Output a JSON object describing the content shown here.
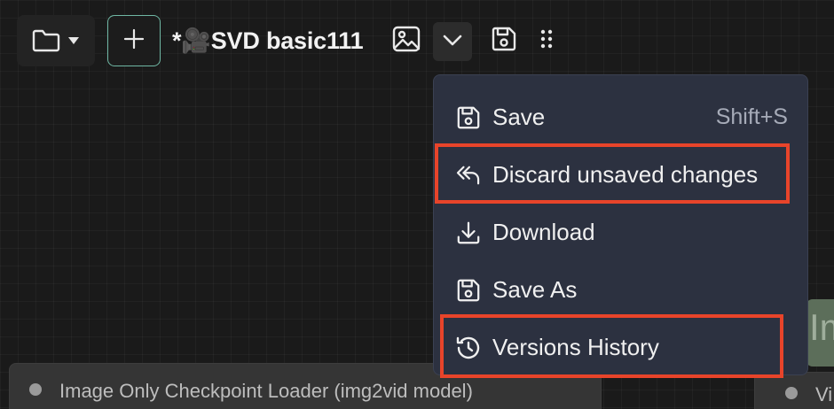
{
  "toolbar": {
    "workflow_title": "*🎥SVD basic111",
    "icons": {
      "workflow_menu": "folder-icon",
      "workflow_menu_caret": "caret-down-icon",
      "new_tab": "plus-icon",
      "image": "image-icon",
      "actions_menu": "chevron-down-icon",
      "save": "save-icon",
      "drag": "drag-handle-icon"
    }
  },
  "dropdown": {
    "items": [
      {
        "label": "Save",
        "shortcut": "Shift+S",
        "icon": "save-icon"
      },
      {
        "label": "Discard unsaved changes",
        "icon": "undo-icon"
      },
      {
        "label": "Download",
        "icon": "download-icon"
      },
      {
        "label": "Save As",
        "icon": "save-icon"
      },
      {
        "label": "Versions History",
        "icon": "history-icon"
      }
    ]
  },
  "canvas": {
    "nodes": [
      {
        "title": "Image Only Checkpoint Loader (img2vid model)"
      },
      {
        "title": "Vi"
      },
      {
        "title": "Ima"
      }
    ]
  },
  "colors": {
    "accent_border": "#6fb7a4",
    "menu_background": "#2c3140",
    "highlight": "#e8442a",
    "canvas_background": "#1a1a1a"
  }
}
